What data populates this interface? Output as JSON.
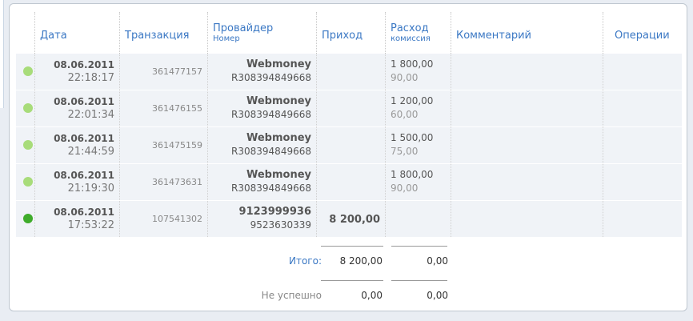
{
  "columns": {
    "date": "Дата",
    "transaction": "Транзакция",
    "provider": "Провайдер",
    "provider_sub": "Номер",
    "income": "Приход",
    "expense": "Расход",
    "expense_sub": "комиссия",
    "comment": "Комментарий",
    "operations": "Операции"
  },
  "rows": [
    {
      "status": "light",
      "date": "08.06.2011",
      "time": "22:18:17",
      "transaction": "361477157",
      "provider": "Webmoney",
      "number": "R308394849668",
      "income": "",
      "expense": "1 800,00",
      "commission": "90,00"
    },
    {
      "status": "light",
      "date": "08.06.2011",
      "time": "22:01:34",
      "transaction": "361476155",
      "provider": "Webmoney",
      "number": "R308394849668",
      "income": "",
      "expense": "1 200,00",
      "commission": "60,00"
    },
    {
      "status": "light",
      "date": "08.06.2011",
      "time": "21:44:59",
      "transaction": "361475159",
      "provider": "Webmoney",
      "number": "R308394849668",
      "income": "",
      "expense": "1 500,00",
      "commission": "75,00"
    },
    {
      "status": "light",
      "date": "08.06.2011",
      "time": "21:19:30",
      "transaction": "361473631",
      "provider": "Webmoney",
      "number": "R308394849668",
      "income": "",
      "expense": "1 800,00",
      "commission": "90,00"
    },
    {
      "status": "dark",
      "date": "08.06.2011",
      "time": "17:53:22",
      "transaction": "107541302",
      "provider": "9123999936",
      "number": "9523630339",
      "income": "8 200,00",
      "expense": "",
      "commission": ""
    }
  ],
  "totals": {
    "total_label": "Итого:",
    "total_income": "8 200,00",
    "total_expense": "0,00",
    "failed_label": "Не успешно",
    "failed_income": "0,00",
    "failed_expense": "0,00"
  },
  "colors": {
    "accent": "#3b78c4",
    "status_success_light": "#a8dc7a",
    "status_success_dark": "#3fac2b",
    "row_bg": "#f0f3f7"
  }
}
